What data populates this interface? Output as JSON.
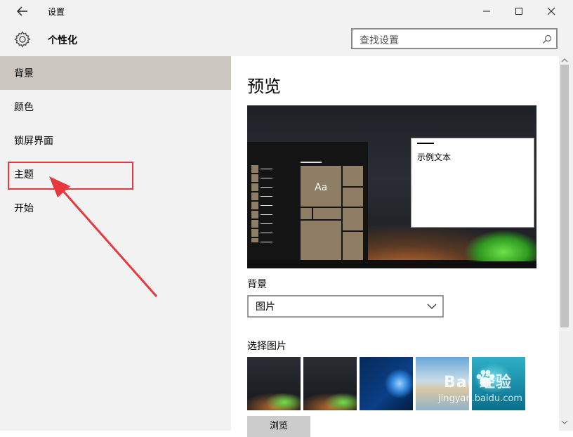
{
  "window": {
    "title": "设置"
  },
  "header": {
    "title": "个性化",
    "search_placeholder": "查找设置"
  },
  "sidebar": {
    "items": [
      {
        "label": "背景"
      },
      {
        "label": "颜色"
      },
      {
        "label": "锁屏界面"
      },
      {
        "label": "主题"
      },
      {
        "label": "开始"
      }
    ]
  },
  "main": {
    "preview_heading": "预览",
    "preview_sample_text": "示例文本",
    "preview_tile_label": "Aa",
    "background_label": "背景",
    "background_value": "图片",
    "choose_picture_label": "选择图片",
    "browse_button": "浏览"
  },
  "watermark": {
    "text": "Bai 经验",
    "url_text": "jingyan.baidu.com"
  },
  "colors": {
    "selected_item_bg": "#cbc7c0",
    "annotation": "#e8383d",
    "tile": "#8e7e66",
    "window_bg": "#f2f2f2"
  }
}
